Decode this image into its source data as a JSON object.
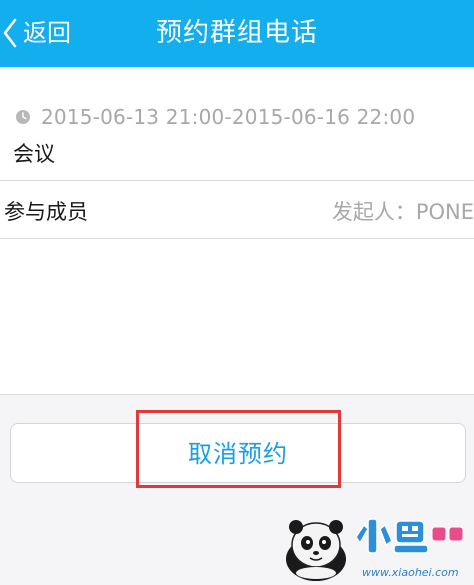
{
  "header": {
    "back_label": "返回",
    "title": "预约群组电话"
  },
  "meeting": {
    "time_range": "2015-06-13 21:00-2015-06-16 22:00",
    "type": "会议"
  },
  "members": {
    "label": "参与成员",
    "initiator": "发起人：PONE"
  },
  "actions": {
    "cancel_label": "取消预约"
  },
  "watermark": {
    "site": "www.xiaohei.com",
    "logo_text": "小黑游戏"
  },
  "colors": {
    "header_bg": "#12aeee",
    "accent": "#1a9ee8",
    "highlight": "#e03a3a"
  }
}
